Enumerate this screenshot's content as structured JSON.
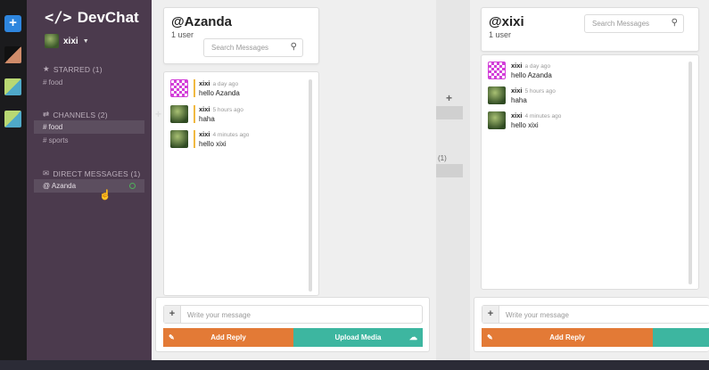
{
  "app": {
    "brand": "DevChat",
    "brand_icon": "code-icon"
  },
  "user": {
    "name": "xixi"
  },
  "sidebar": {
    "starred_header": "STARRED (1)",
    "starred": [
      "# food"
    ],
    "channels_header": "CHANNELS (2)",
    "channels": [
      "# food",
      "# sports"
    ],
    "dm_header": "DIRECT MESSAGES (1)",
    "dms": [
      "@ Azanda"
    ]
  },
  "left_panel": {
    "title": "@Azanda",
    "subtitle": "1 user",
    "search_placeholder": "Search Messages",
    "messages": [
      {
        "author": "xixi",
        "time": "a day ago",
        "text": "hello Azanda"
      },
      {
        "author": "xixi",
        "time": "5 hours ago",
        "text": "haha"
      },
      {
        "author": "xixi",
        "time": "4 minutes ago",
        "text": "hello xixi"
      }
    ],
    "compose_placeholder": "Write your message",
    "reply_label": "Add Reply",
    "upload_label": "Upload Media"
  },
  "right_panel": {
    "title": "@xixi",
    "subtitle": "1 user",
    "search_placeholder": "Search Messages",
    "messages": [
      {
        "author": "xixi",
        "time": "a day ago",
        "text": "hello Azanda"
      },
      {
        "author": "xixi",
        "time": "5 hours ago",
        "text": "haha"
      },
      {
        "author": "xixi",
        "time": "4 minutes ago",
        "text": "hello xixi"
      }
    ],
    "compose_placeholder": "Write your message",
    "reply_label": "Add Reply"
  },
  "ghost": {
    "plus": "+",
    "count": "(1)"
  },
  "colors": {
    "sidebar": "#4b3a4d",
    "reply": "#e37a36",
    "upload": "#3db6a0",
    "accent_line": "#f0b840"
  }
}
